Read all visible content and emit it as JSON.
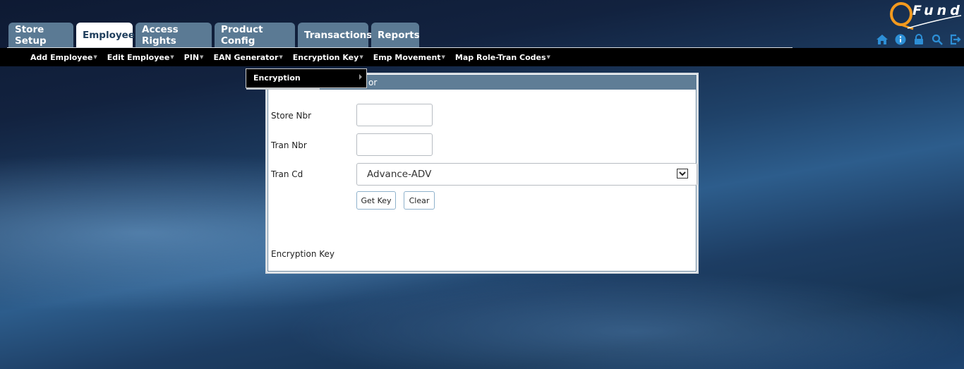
{
  "logo": {
    "text": "Fund"
  },
  "tabs": [
    {
      "label": "Store Setup"
    },
    {
      "label": "Employee"
    },
    {
      "label": "Access Rights"
    },
    {
      "label": "Product Config"
    },
    {
      "label": "Transactions"
    },
    {
      "label": "Reports"
    }
  ],
  "subnav": [
    {
      "label": "Add Employee"
    },
    {
      "label": "Edit Employee"
    },
    {
      "label": "PIN"
    },
    {
      "label": "EAN Generator"
    },
    {
      "label": "Encryption Key"
    },
    {
      "label": "Emp Movement"
    },
    {
      "label": "Map Role-Tran Codes"
    }
  ],
  "dropdown": {
    "item": "Encryption"
  },
  "panel": {
    "title_visible": "or",
    "fields": {
      "store_nbr_label": "Store Nbr",
      "store_nbr_value": "",
      "tran_nbr_label": "Tran Nbr",
      "tran_nbr_value": "",
      "tran_cd_label": "Tran Cd",
      "tran_cd_value": "Advance-ADV",
      "encryption_key_label": "Encryption Key"
    },
    "buttons": {
      "get_key": "Get Key",
      "clear": "Clear"
    }
  },
  "header_icons": [
    "home-icon",
    "info-icon",
    "lock-icon",
    "search-icon",
    "logout-icon"
  ],
  "colors": {
    "tab_bg": "#5b7a94",
    "panel_header": "#5f7d96",
    "subnav_bg": "#000000"
  }
}
